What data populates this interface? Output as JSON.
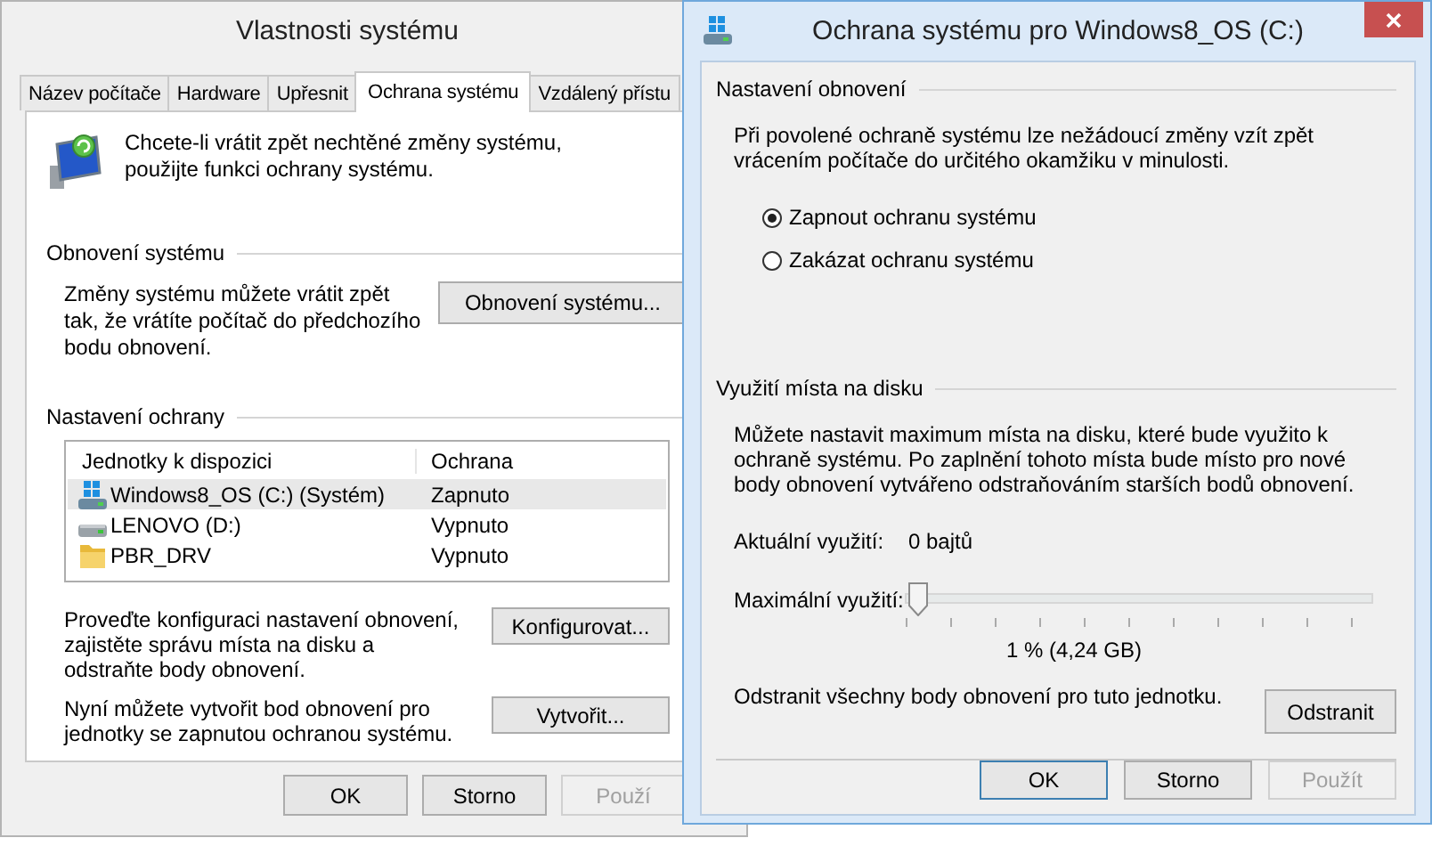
{
  "back_window": {
    "title": "Vlastnosti systému",
    "tabs": [
      {
        "label": "Název počítače",
        "selected": false
      },
      {
        "label": "Hardware",
        "selected": false
      },
      {
        "label": "Upřesnit",
        "selected": false
      },
      {
        "label": "Ochrana systému",
        "selected": true
      },
      {
        "label": "Vzdálený přístu",
        "selected": false
      }
    ],
    "intro": "Chcete-li vrátit zpět nechtěné změny systému, použijte funkci ochrany systému.",
    "restore_group": {
      "title": "Obnovení systému",
      "text": "Změny systému můžete vrátit zpět tak, že vrátíte počítač do předchozího bodu obnovení.",
      "button": "Obnovení systému..."
    },
    "protection_group": {
      "title": "Nastavení ochrany",
      "columns": [
        "Jednotky k dispozici",
        "Ochrana"
      ],
      "drives": [
        {
          "name": "Windows8_OS (C:) (Systém)",
          "protection": "Zapnuto",
          "kind": "system",
          "selected": true
        },
        {
          "name": "LENOVO (D:)",
          "protection": "Vypnuto",
          "kind": "drive",
          "selected": false
        },
        {
          "name": "PBR_DRV",
          "protection": "Vypnuto",
          "kind": "folder",
          "selected": false
        }
      ],
      "actions": [
        {
          "text": "Proveďte konfiguraci nastavení obnovení, zajistěte správu místa na disku a odstraňte body obnovení.",
          "button": "Konfigurovat..."
        },
        {
          "text": "Nyní můžete vytvořit bod obnovení pro jednotky se zapnutou ochranou systému.",
          "button": "Vytvořit..."
        }
      ]
    },
    "buttons": [
      {
        "label": "OK",
        "disabled": false
      },
      {
        "label": "Storno",
        "disabled": false
      },
      {
        "label": "Použí",
        "disabled": true
      }
    ]
  },
  "front_window": {
    "title": "Ochrana systému pro Windows8_OS (C:)",
    "restore_settings": {
      "title": "Nastavení obnovení",
      "text": "Při povolené ochraně systému lze nežádoucí změny vzít zpět vrácením počítače do určitého okamžiku v minulosti.",
      "options": [
        {
          "label": "Zapnout ochranu systému",
          "selected": true
        },
        {
          "label": "Zakázat ochranu systému",
          "selected": false
        }
      ]
    },
    "disk_usage": {
      "title": "Využití místa na disku",
      "text": "Můžete nastavit maximum místa na disku, které bude využito k ochraně systému. Po zaplnění tohoto místa bude místo pro nové body obnovení vytvářeno odstraňováním starších bodů obnovení.",
      "current_label": "Aktuální využití:",
      "current_value": "0 bajtů",
      "max_label": "Maximální využití:",
      "max_slider": {
        "level": 0.01
      },
      "max_reading": "1 % (4,24 GB)",
      "delete_text": "Odstranit všechny body obnovení pro tuto jednotku.",
      "delete_button": "Odstranit"
    },
    "buttons": [
      {
        "label": "OK",
        "disabled": false,
        "default": true
      },
      {
        "label": "Storno",
        "disabled": false,
        "default": false
      },
      {
        "label": "Použít",
        "disabled": true,
        "default": false
      }
    ]
  }
}
